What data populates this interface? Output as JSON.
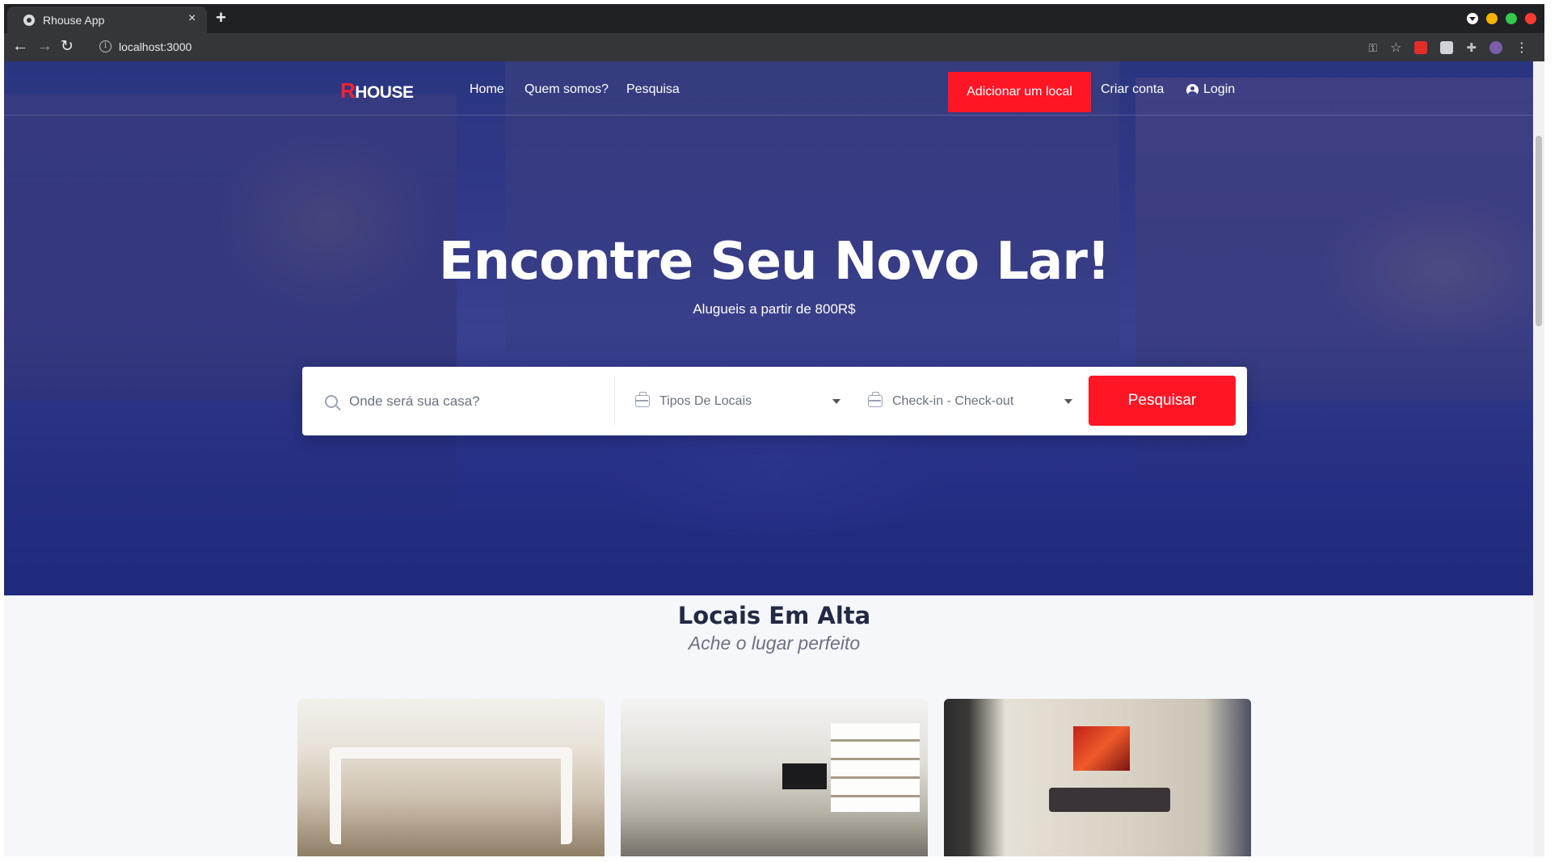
{
  "browser": {
    "tab_title": "Rhouse App",
    "tab_close": "×",
    "new_tab": "+",
    "url": "localhost:3000",
    "back": "←",
    "forward": "→",
    "reload": "↻"
  },
  "nav": {
    "logo_letter": "R",
    "logo_text": "HOUSE",
    "links": [
      "Home",
      "Quem somos?",
      "Pesquisa"
    ],
    "add_place": "Adicionar um local",
    "signup": "Criar conta",
    "login": "Login"
  },
  "hero": {
    "title": "Encontre Seu Novo Lar!",
    "subtitle": "Alugueis a partir de 800R$"
  },
  "search": {
    "placeholder": "Onde será sua casa?",
    "type_select": "Tipos De Locais",
    "date_select": "Check-in - Check-out",
    "button": "Pesquisar"
  },
  "section": {
    "title": "Locais Em Alta",
    "subtitle": "Ache o lugar perfeito"
  },
  "colors": {
    "accent": "#fe1624",
    "heading": "#222a44"
  }
}
